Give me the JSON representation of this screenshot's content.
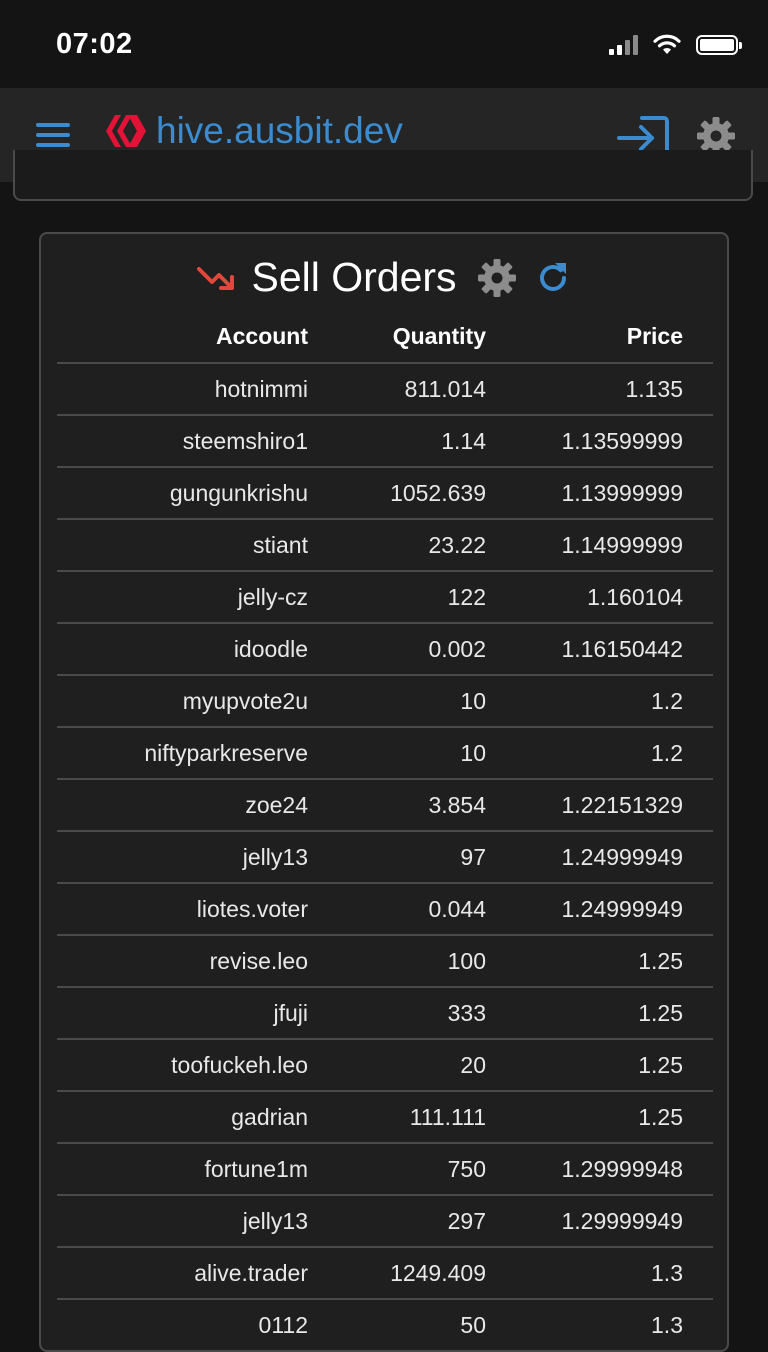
{
  "status_bar": {
    "time": "07:02"
  },
  "header": {
    "brand_name": "hive.ausbit.dev",
    "accent_color": "#3a8bd0",
    "logo_color": "#e31337",
    "icons": [
      "menu-icon",
      "hive-logo-icon",
      "login-icon",
      "gear-icon"
    ]
  },
  "sell_orders": {
    "title": "Sell Orders",
    "trend_color": "#e2473b",
    "icons": [
      "trending-down-icon",
      "gear-icon",
      "refresh-icon"
    ],
    "columns": [
      "Account",
      "Quantity",
      "Price"
    ],
    "rows": [
      {
        "account": "hotnimmi",
        "quantity": "811.014",
        "price": "1.135"
      },
      {
        "account": "steemshiro1",
        "quantity": "1.14",
        "price": "1.13599999"
      },
      {
        "account": "gungunkrishu",
        "quantity": "1052.639",
        "price": "1.13999999"
      },
      {
        "account": "stiant",
        "quantity": "23.22",
        "price": "1.14999999"
      },
      {
        "account": "jelly-cz",
        "quantity": "122",
        "price": "1.160104"
      },
      {
        "account": "idoodle",
        "quantity": "0.002",
        "price": "1.16150442"
      },
      {
        "account": "myupvote2u",
        "quantity": "10",
        "price": "1.2"
      },
      {
        "account": "niftyparkreserve",
        "quantity": "10",
        "price": "1.2"
      },
      {
        "account": "zoe24",
        "quantity": "3.854",
        "price": "1.22151329"
      },
      {
        "account": "jelly13",
        "quantity": "97",
        "price": "1.24999949"
      },
      {
        "account": "liotes.voter",
        "quantity": "0.044",
        "price": "1.24999949"
      },
      {
        "account": "revise.leo",
        "quantity": "100",
        "price": "1.25"
      },
      {
        "account": "jfuji",
        "quantity": "333",
        "price": "1.25"
      },
      {
        "account": "toofuckeh.leo",
        "quantity": "20",
        "price": "1.25"
      },
      {
        "account": "gadrian",
        "quantity": "111.111",
        "price": "1.25"
      },
      {
        "account": "fortune1m",
        "quantity": "750",
        "price": "1.29999948"
      },
      {
        "account": "jelly13",
        "quantity": "297",
        "price": "1.29999949"
      },
      {
        "account": "alive.trader",
        "quantity": "1249.409",
        "price": "1.3"
      },
      {
        "account": "0112",
        "quantity": "50",
        "price": "1.3"
      }
    ]
  }
}
